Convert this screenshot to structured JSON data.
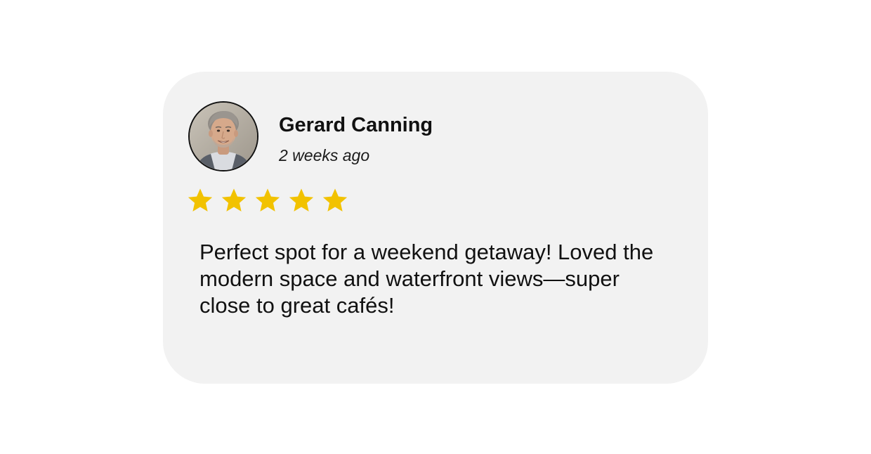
{
  "review": {
    "reviewer_name": "Gerard Canning",
    "time_ago": "2 weeks ago",
    "rating": 5,
    "max_rating": 5,
    "star_color": "#f2c200",
    "avatar_icon": "user-avatar-photo",
    "text": "Perfect spot for a weekend getaway! Loved the modern space and waterfront views—super close to great cafés!"
  }
}
